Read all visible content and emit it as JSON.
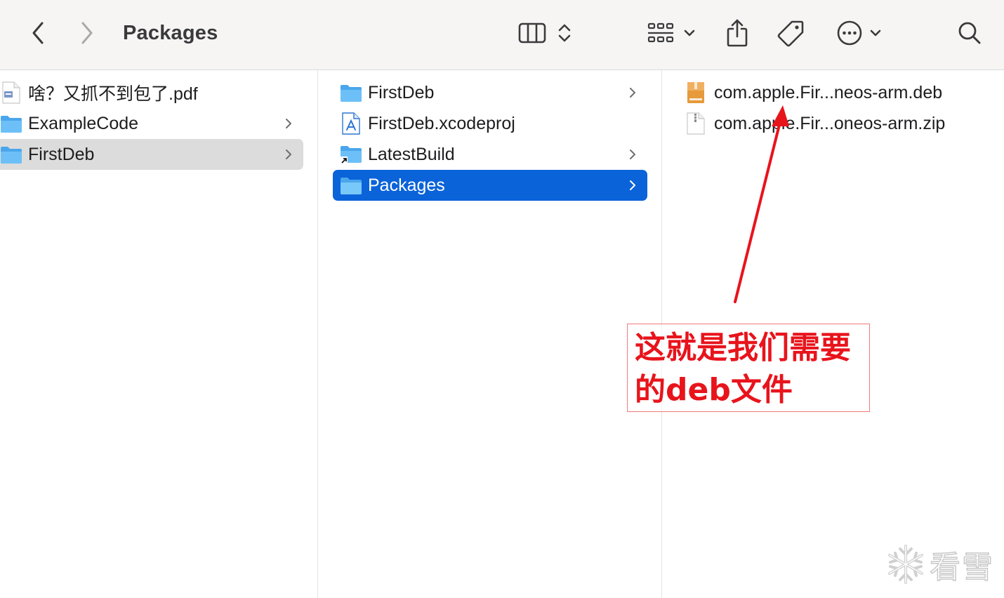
{
  "window": {
    "title": "Packages"
  },
  "toolbar": {
    "icons": [
      "chevron-left-icon",
      "chevron-right-icon",
      "column-view-icon",
      "sort-updown-icon",
      "grid-group-icon",
      "chevron-down-icon",
      "share-icon",
      "tag-icon",
      "more-icon",
      "chevron-down-icon",
      "search-icon"
    ]
  },
  "columns": [
    {
      "items": [
        {
          "label": "啥？又抓不到包了.pdf",
          "icon": "pdf-document-icon",
          "has_children": false,
          "state": "normal"
        },
        {
          "label": "ExampleCode",
          "icon": "folder-icon",
          "has_children": true,
          "state": "normal"
        },
        {
          "label": "FirstDeb",
          "icon": "folder-icon",
          "has_children": true,
          "state": "parent-selected"
        }
      ]
    },
    {
      "items": [
        {
          "label": "FirstDeb",
          "icon": "folder-icon",
          "has_children": true,
          "state": "normal"
        },
        {
          "label": "FirstDeb.xcodeproj",
          "icon": "xcodeproj-icon",
          "has_children": false,
          "state": "normal"
        },
        {
          "label": "LatestBuild",
          "icon": "folder-alias-icon",
          "has_children": true,
          "state": "normal"
        },
        {
          "label": "Packages",
          "icon": "folder-icon",
          "has_children": true,
          "state": "selected"
        }
      ]
    },
    {
      "items": [
        {
          "label": "com.apple.Fir...neos-arm.deb",
          "icon": "archive-icon",
          "has_children": false,
          "state": "normal"
        },
        {
          "label": "com.apple.Fir...oneos-arm.zip",
          "icon": "zip-icon",
          "has_children": false,
          "state": "normal"
        }
      ]
    }
  ],
  "annotation": {
    "text_line1": "这就是我们需要",
    "text_line2": "的deb文件",
    "color": "#e8141c"
  },
  "watermark": {
    "text": "看雪",
    "icon": "snowflake-icon"
  },
  "colors": {
    "selection": "#0a63d9",
    "parent_selection": "#dcdcdc",
    "folder": "#5ab2f2",
    "toolbar_bg": "#f6f5f4"
  }
}
